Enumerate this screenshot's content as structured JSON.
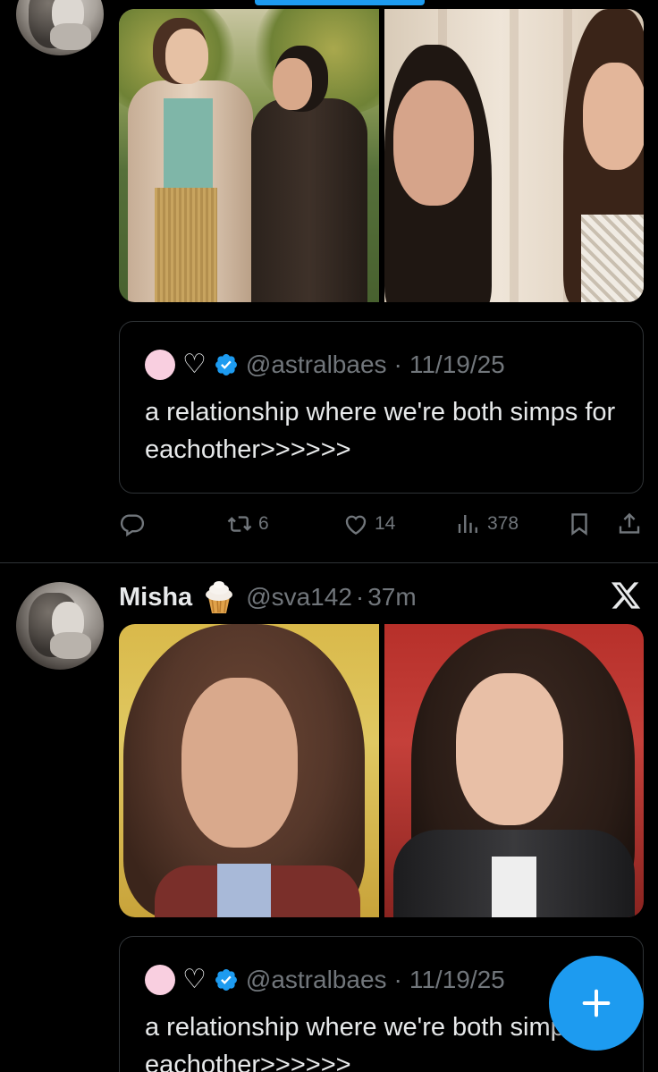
{
  "tweet1": {
    "quote": {
      "heart": "♡",
      "handle": "@astralbaes",
      "separator": "·",
      "date": "11/19/25",
      "text": "a relationship where we're both simps for eachother>>>>>>"
    },
    "actions": {
      "retweets": "6",
      "likes": "14",
      "views": "378"
    }
  },
  "tweet2": {
    "author_name": "Misha",
    "emoji": "🧁",
    "handle": "@sva142",
    "separator": "·",
    "time": "37m",
    "quote": {
      "heart": "♡",
      "handle": "@astralbaes",
      "separator": "·",
      "date": "11/19/25",
      "text": "a relationship where we're both simps for eachother>>>>>>"
    }
  },
  "icons": [
    "reply-icon",
    "retweet-icon",
    "like-icon",
    "views-icon",
    "bookmark-icon",
    "share-icon",
    "x-logo-icon",
    "compose-plus-icon",
    "verified-badge-icon"
  ],
  "colors": {
    "background": "#000000",
    "accent": "#1d9bf0",
    "muted_text": "#71767b",
    "text": "#e7e9ea",
    "border": "#2f3336",
    "quote_avatar": "#f9cfe0"
  }
}
